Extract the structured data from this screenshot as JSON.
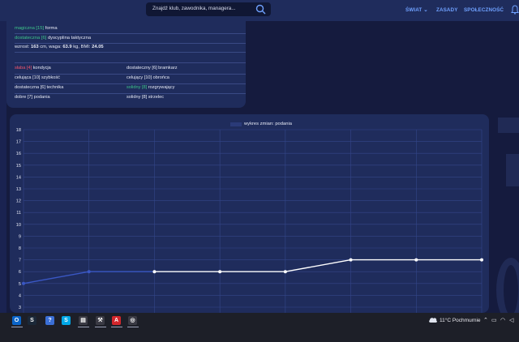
{
  "header": {
    "search_placeholder": "Znajdź klub, zawodnika, managera...",
    "nav": [
      "ŚWIAT",
      "ZASADY",
      "SPOŁECZNOŚĆ"
    ]
  },
  "player": {
    "form": {
      "level": "magiczna [15]",
      "name": "forma"
    },
    "discipline": {
      "level": "dostateczna [6]",
      "name": "dyscyplina taktyczna"
    },
    "body": {
      "label_height": "wzrost:",
      "height": "163",
      "label_cm_weight": "cm, waga:",
      "weight": "63.9",
      "label_kg_bmi": "kg, BMI:",
      "bmi": "24.05"
    },
    "skills": [
      {
        "level": "słaba [4]",
        "name": "kondycja",
        "color": "#f0566d"
      },
      {
        "level": "dostateczny [6]",
        "name": "bramkarz",
        "color": "#e6e9f5"
      },
      {
        "level": "celująca [10]",
        "name": "szybkość",
        "color": "#e6e9f5"
      },
      {
        "level": "celujący [10]",
        "name": "obrońca",
        "color": "#e6e9f5"
      },
      {
        "level": "dostateczna [6]",
        "name": "technika",
        "color": "#e6e9f5"
      },
      {
        "level": "solidny [8]",
        "name": "rozgrywający",
        "color": "#3ec48a"
      },
      {
        "level": "dobre [7]",
        "name": "podania",
        "color": "#e6e9f5"
      },
      {
        "level": "solidny [8]",
        "name": "strzelec",
        "color": "#e6e9f5"
      }
    ]
  },
  "chart_data": {
    "type": "line",
    "title": "",
    "xlabel": "",
    "ylabel": "",
    "legend": "wykres zmian: podania",
    "yticks": [
      "18",
      "17",
      "16",
      "15",
      "14",
      "13",
      "12",
      "11",
      "10",
      "9",
      "8",
      "7",
      "6",
      "5",
      "4",
      "3"
    ],
    "ylim": [
      3,
      18
    ],
    "x": [
      0,
      1,
      2,
      3,
      4,
      5,
      6,
      7
    ],
    "values": [
      5,
      6,
      6,
      6,
      6,
      7,
      7,
      7
    ],
    "line_color_early": "#3a57c4",
    "line_color_late": "#ffffff",
    "grid": true
  },
  "taskbar": {
    "weather": "11°C  Pochmurnie",
    "apps": [
      {
        "name": "outlook-icon",
        "glyph": "O",
        "color": "#0a64c8"
      },
      {
        "name": "steam-icon",
        "glyph": "S",
        "color": "#1b2838"
      },
      {
        "name": "app-icon",
        "glyph": "?",
        "color": "#3b6fd6"
      },
      {
        "name": "skype-icon",
        "glyph": "S",
        "color": "#00a8e8"
      },
      {
        "name": "terminal-icon",
        "glyph": "▤",
        "color": "#3a3a44"
      },
      {
        "name": "tools-icon",
        "glyph": "⚒",
        "color": "#3a3a44"
      },
      {
        "name": "pdf-icon",
        "glyph": "A",
        "color": "#d3262c"
      },
      {
        "name": "network-icon",
        "glyph": "◎",
        "color": "#3a3a44"
      }
    ]
  }
}
